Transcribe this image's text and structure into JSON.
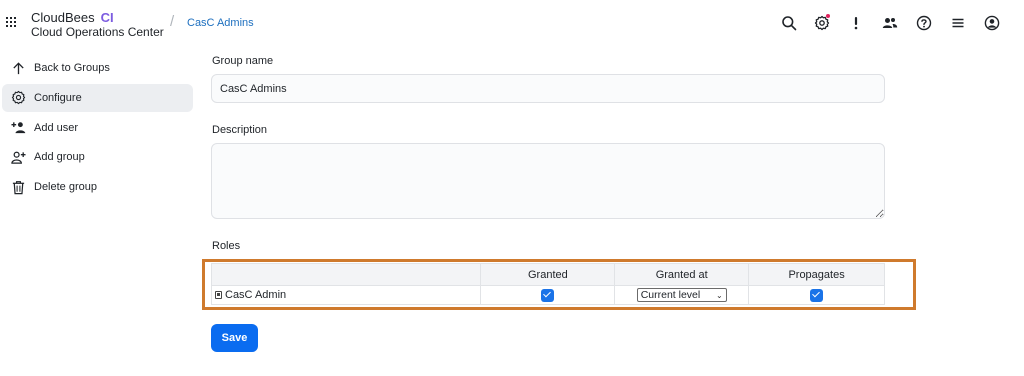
{
  "header": {
    "brand_name": "CloudBees",
    "brand_product": "CI",
    "brand_subtitle": "Cloud Operations Center",
    "breadcrumb_sep": "/",
    "breadcrumb": "CasC Admins",
    "icons": [
      "search-icon",
      "manage-gear-icon",
      "alert-icon",
      "people-icon",
      "help-icon",
      "menu-icon",
      "user-account-icon"
    ],
    "notification_color": "#e0245e"
  },
  "sidebar": {
    "items": [
      {
        "label": "Back to Groups",
        "icon": "arrow-up-icon"
      },
      {
        "label": "Configure",
        "icon": "gear-icon",
        "active": true
      },
      {
        "label": "Add user",
        "icon": "add-user-icon"
      },
      {
        "label": "Add group",
        "icon": "add-group-icon"
      },
      {
        "label": "Delete group",
        "icon": "trash-icon"
      }
    ]
  },
  "form": {
    "group_name_label": "Group name",
    "group_name_value": "CasC Admins",
    "description_label": "Description",
    "description_value": "",
    "roles_label": "Roles",
    "roles_table": {
      "columns": [
        "",
        "Granted",
        "Granted at",
        "Propagates"
      ],
      "rows": [
        {
          "name": "CasC Admin",
          "granted": true,
          "granted_at": "Current level",
          "propagates": true
        }
      ]
    },
    "save_label": "Save"
  },
  "colors": {
    "accent": "#0a6cf0",
    "highlight_border": "#cf7a2d",
    "brand_ci": "#7c5ce0",
    "link": "#1d6fbf"
  }
}
